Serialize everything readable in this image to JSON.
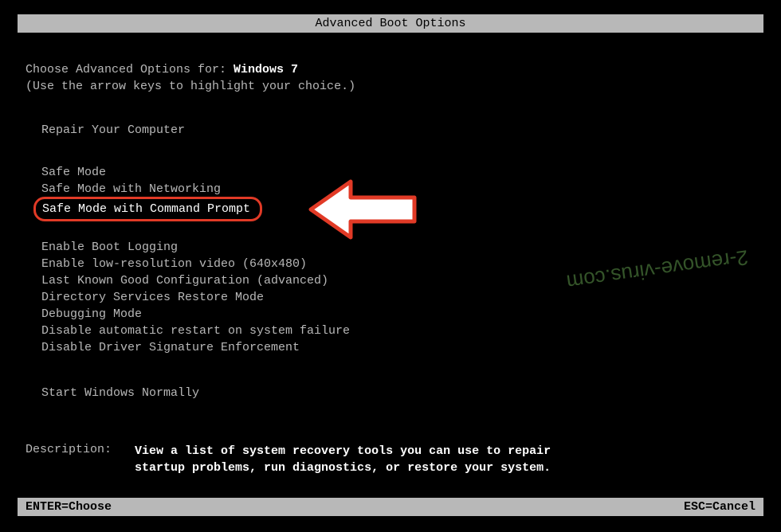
{
  "title": "Advanced Boot Options",
  "header": {
    "prefix": "Choose Advanced Options for: ",
    "os_name": "Windows 7",
    "instruction": "(Use the arrow keys to highlight your choice.)"
  },
  "menu": {
    "repair": "Repair Your Computer",
    "safe_mode": "Safe Mode",
    "safe_mode_net": "Safe Mode with Networking",
    "safe_mode_cmd": "Safe Mode with Command Prompt",
    "boot_logging": "Enable Boot Logging",
    "low_res": "Enable low-resolution video (640x480)",
    "last_known": "Last Known Good Configuration (advanced)",
    "ds_restore": "Directory Services Restore Mode",
    "debugging": "Debugging Mode",
    "disable_restart": "Disable automatic restart on system failure",
    "disable_sig": "Disable Driver Signature Enforcement",
    "start_normal": "Start Windows Normally"
  },
  "description": {
    "label": "Description:",
    "text": "View a list of system recovery tools you can use to repair startup problems, run diagnostics, or restore your system."
  },
  "footer": {
    "enter": "ENTER=Choose",
    "esc": "ESC=Cancel"
  },
  "watermark": "2-remove-virus.com"
}
